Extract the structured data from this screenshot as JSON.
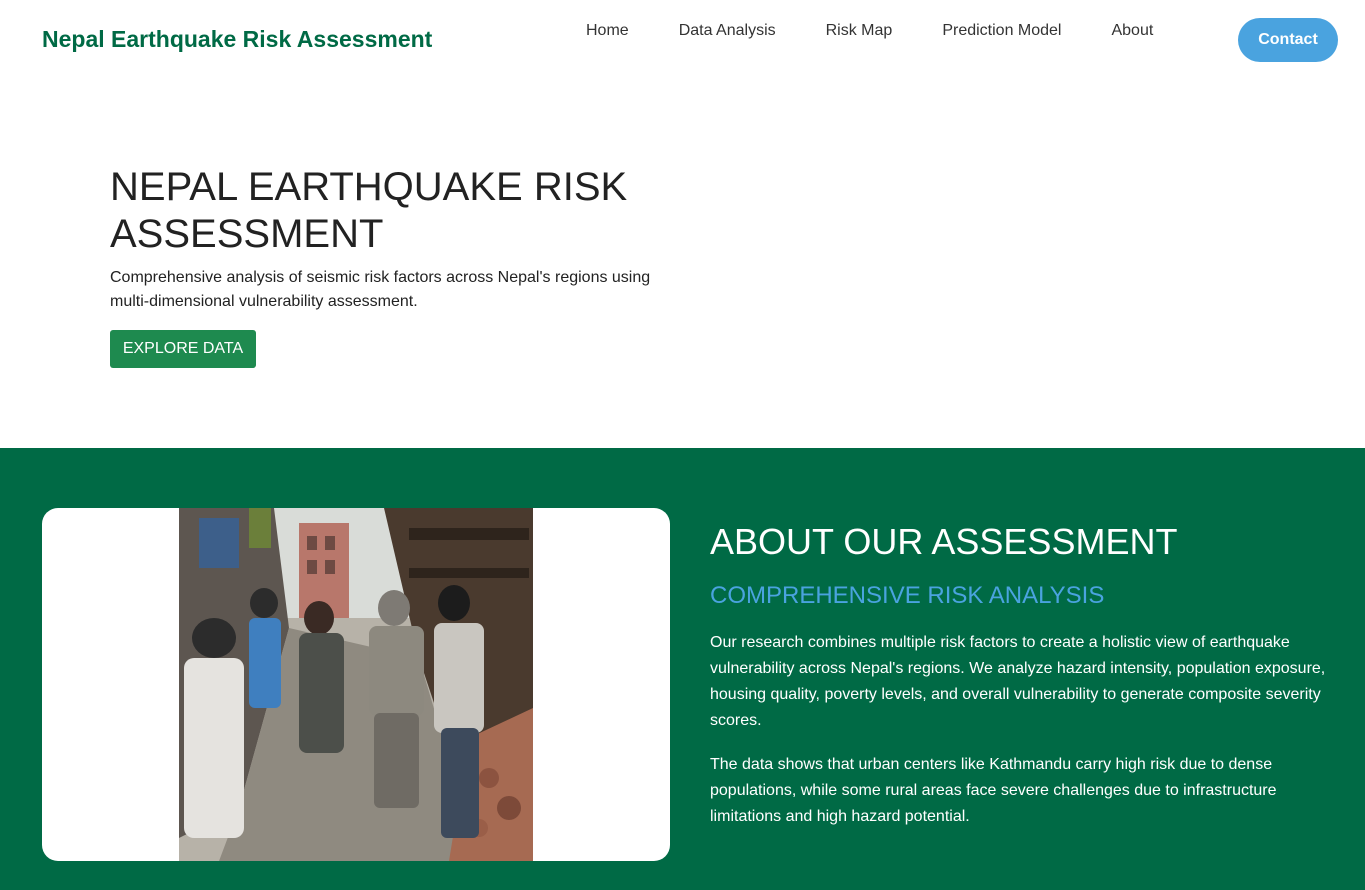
{
  "navbar": {
    "brand": "Nepal Earthquake Risk Assessment",
    "links": [
      "Home",
      "Data Analysis",
      "Risk Map",
      "Prediction Model",
      "About"
    ],
    "contact_label": "Contact"
  },
  "hero": {
    "title": "NEPAL EARTHQUAKE RISK ASSESSMENT",
    "description": "Comprehensive analysis of seismic risk factors across Nepal's regions using multi-dimensional vulnerability assessment.",
    "button_label": "EXPLORE DATA"
  },
  "about": {
    "title": "ABOUT OUR ASSESSMENT",
    "subtitle": "COMPREHENSIVE RISK ANALYSIS",
    "paragraph1": "Our research combines multiple risk factors to create a holistic view of earthquake vulnerability across Nepal's regions. We analyze hazard intensity, population exposure, housing quality, poverty levels, and overall vulnerability to generate composite severity scores.",
    "paragraph2": "The data shows that urban centers like Kathmandu carry high risk due to dense populations, while some rural areas face severe challenges due to infrastructure limitations and high hazard potential."
  },
  "colors": {
    "brand_green": "#006a45",
    "button_green": "#1e8a4f",
    "accent_blue": "#4aa3df"
  }
}
